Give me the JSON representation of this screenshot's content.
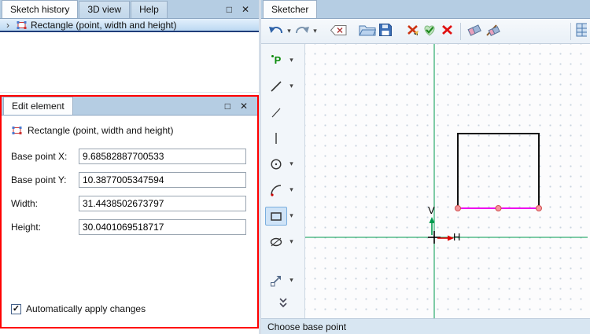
{
  "icons": {
    "maximize": "□",
    "close": "✕",
    "dropdown": "▾",
    "expander": "›",
    "check": "✓",
    "point_tool": "P"
  },
  "left_panel": {
    "tabs": [
      "Sketch history",
      "3D view",
      "Help"
    ],
    "tree": {
      "selected_item": "Rectangle (point, width and height)"
    }
  },
  "edit_panel": {
    "tab": "Edit element",
    "element_title": "Rectangle (point, width and height)",
    "fields": [
      {
        "label": "Base point X:",
        "value": "9.68582887700533"
      },
      {
        "label": "Base point Y:",
        "value": "10.3877005347594"
      },
      {
        "label": "Width:",
        "value": "31.4438502673797"
      },
      {
        "label": "Height:",
        "value": "30.0401069518717"
      }
    ],
    "auto_apply": {
      "label": "Automatically apply changes",
      "checked": true
    }
  },
  "sketcher": {
    "tab": "Sketcher",
    "status": "Choose base point",
    "axes": {
      "vertical_label": "V",
      "horizontal_label": "H"
    }
  },
  "colors": {
    "axis_green": "#009a4e",
    "selection_magenta": "#ee00ee",
    "highlight_red": "#ff0000"
  }
}
